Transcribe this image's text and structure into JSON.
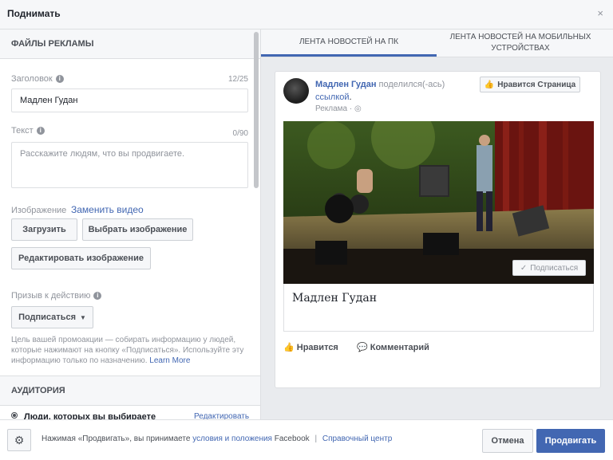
{
  "dialog": {
    "title": "Поднимать",
    "close": "×"
  },
  "left": {
    "section_title": "ФАЙЛЫ РЕКЛАМЫ",
    "headline": {
      "label": "Заголовок",
      "counter": "12/25",
      "value": "Мадлен Гудан"
    },
    "text": {
      "label": "Текст",
      "counter": "0/90",
      "placeholder": "Расскажите людям, что вы продвигаете."
    },
    "image": {
      "label": "Изображение",
      "replace_link": "Заменить видео",
      "upload": "Загрузить",
      "choose": "Выбрать изображение",
      "edit": "Редактировать изображение"
    },
    "cta": {
      "label": "Призыв к действию",
      "value": "Подписаться"
    },
    "help": "Цель вашей промоакции — собирать информацию у людей, которые нажимают на кнопку «Подписаться». Используйте эту информацию только по назначению.",
    "learn_more": "Learn More",
    "audience_title": "АУДИТОРИЯ",
    "audience_option": "Люди, которых вы выбираете",
    "audience_edit": "Редактировать"
  },
  "preview": {
    "tabs": [
      "ЛЕНТА НОВОСТЕЙ НА ПК",
      "ЛЕНТА НОВОСТЕЙ НА МОБИЛЬНЫХ УСТРОЙСТВАХ"
    ],
    "page_name": "Мадлен Гудан",
    "shared_text": "поделился(-ась)",
    "shared_link": "ссылкой",
    "sponsored": "Реклама",
    "like_page": "Нравится Страница",
    "link_title": "Мадлен Гудан",
    "subscribe_btn": "Подписаться",
    "like": "Нравится",
    "comment": "Комментарий"
  },
  "footer": {
    "text_before": "Нажимая «Продвигать», вы принимаете",
    "terms_link": "условия и положения",
    "text_after": "Facebook",
    "separator": "|",
    "help_link": "Справочный центр",
    "cancel": "Отмена",
    "promote": "Продвигать"
  },
  "colors": {
    "primary": "#4267b2",
    "border": "#dddfe2"
  }
}
